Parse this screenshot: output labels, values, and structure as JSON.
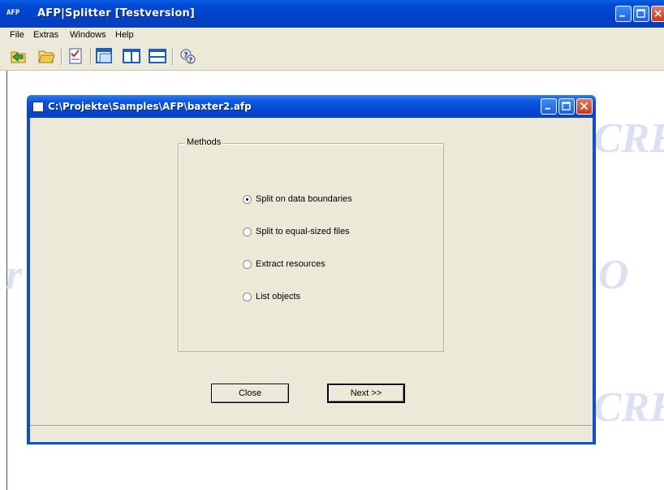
{
  "app": {
    "icon_text": "AFP",
    "title": "AFP|Splitter   [Testversion]"
  },
  "menu": [
    {
      "label": "File"
    },
    {
      "label": "Extras"
    },
    {
      "label": "Windows"
    },
    {
      "label": "Help"
    }
  ],
  "toolbar": {
    "icons": [
      "back-folder-icon",
      "open-folder-icon",
      "checklist-icon",
      "cascade-windows-icon",
      "tile-vertical-icon",
      "tile-horizontal-icon",
      "help-icon"
    ]
  },
  "watermark": {
    "texts": [
      "CRE",
      "O",
      "CRE",
      "r"
    ]
  },
  "child_window": {
    "title": "C:\\Projekte\\Samples\\AFP\\baxter2.afp",
    "group_label": "Methods",
    "options": [
      {
        "label": "Split on data boundaries",
        "checked": true
      },
      {
        "label": "Split to equal-sized files",
        "checked": false
      },
      {
        "label": "Extract resources",
        "checked": false
      },
      {
        "label": "List objects",
        "checked": false
      }
    ],
    "close_label": "Close",
    "next_label": "Next >>"
  },
  "colors": {
    "titlebar": "#0a4fd6",
    "face": "#ece9d8"
  }
}
